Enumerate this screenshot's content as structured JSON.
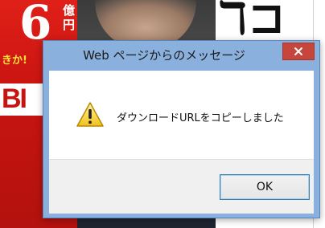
{
  "dialog": {
    "title": "Web ページからのメッセージ",
    "message": "ダウンロードURLをコピーしました",
    "icon": "warning-icon",
    "ok_label": "OK",
    "close_icon": "close-icon"
  },
  "background": {
    "left_big": "6",
    "left_kanji": "億円",
    "left_small": "きか!",
    "left_banner": "BI",
    "right_glyphs": "ℸ⊐"
  },
  "colors": {
    "titlebar": "#8ab0dd",
    "close_button": "#c7463b",
    "ok_border": "#3c7fb1",
    "button_bar": "#f0f0f0"
  }
}
